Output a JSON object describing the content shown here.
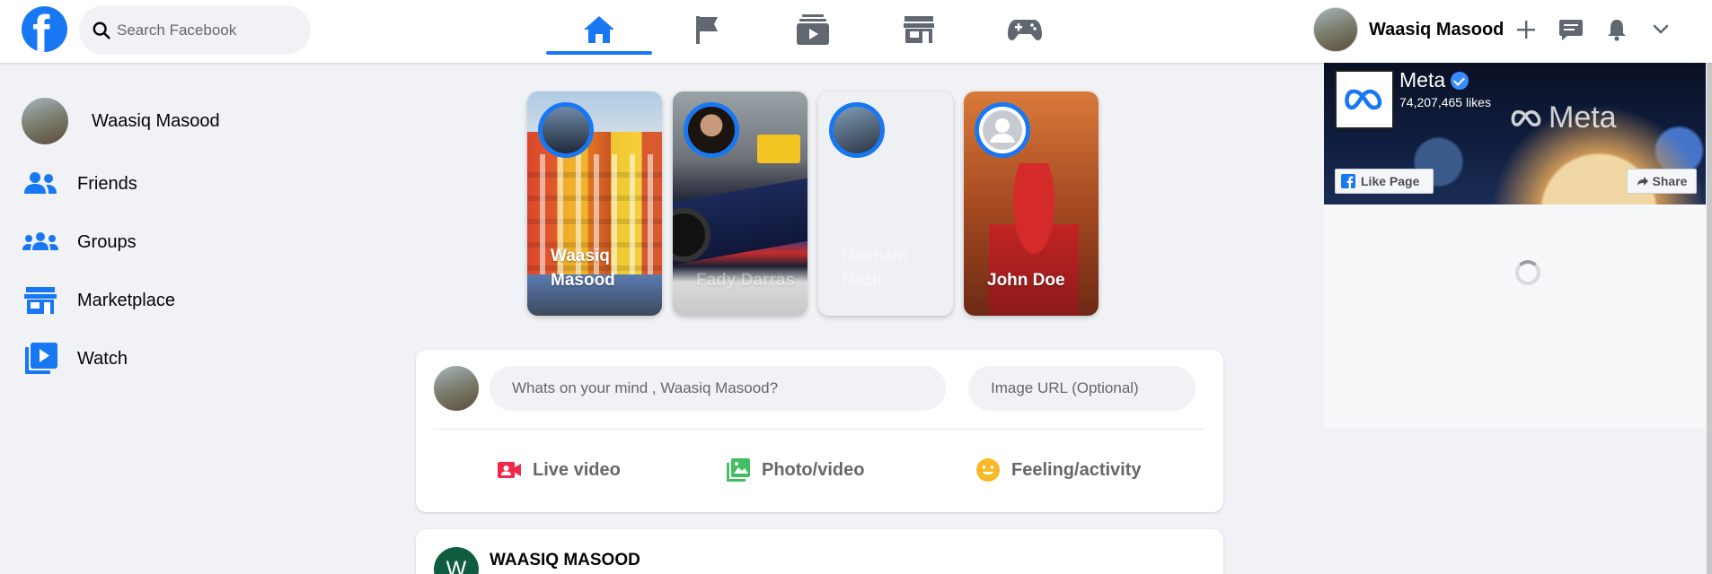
{
  "header": {
    "search": {
      "placeholder": "Search Facebook"
    },
    "nav_tabs": [
      {
        "name": "home",
        "icon": "home-icon",
        "active": true
      },
      {
        "name": "pages",
        "icon": "flag-icon",
        "active": false
      },
      {
        "name": "watch",
        "icon": "video-icon",
        "active": false
      },
      {
        "name": "marketplace",
        "icon": "store-icon",
        "active": false
      },
      {
        "name": "gaming",
        "icon": "gamepad-icon",
        "active": false
      }
    ],
    "profile_name": "Waasiq Masood"
  },
  "sidebar": {
    "profile_name": "Waasiq Masood",
    "items": [
      {
        "label": "Friends",
        "icon": "friends-icon"
      },
      {
        "label": "Groups",
        "icon": "groups-icon"
      },
      {
        "label": "Marketplace",
        "icon": "store-icon"
      },
      {
        "label": "Watch",
        "icon": "video-icon"
      }
    ]
  },
  "stories": [
    {
      "name": "Waasiq Masood"
    },
    {
      "name": "Fady Darras"
    },
    {
      "name": "Hasnain Nazir"
    },
    {
      "name": "John Doe"
    }
  ],
  "composer": {
    "placeholder": "Whats on your mind , Waasiq Masood?",
    "image_placeholder": "Image URL (Optional)",
    "actions": [
      {
        "label": "Live video",
        "icon": "live-video-icon",
        "color": "#f02849"
      },
      {
        "label": "Photo/video",
        "icon": "photo-icon",
        "color": "#45bd62"
      },
      {
        "label": "Feeling/activity",
        "icon": "emoji-icon",
        "color": "#f7b928"
      }
    ]
  },
  "post": {
    "author_initial": "W",
    "author": "WAASIQ MASOOD"
  },
  "page_plugin": {
    "title": "Meta",
    "likes": "74,207,465 likes",
    "watermark": "Meta",
    "like_button": "Like Page",
    "share_button": "Share"
  },
  "colors": {
    "accent": "#1877f2",
    "background": "#f0f2f5",
    "text_secondary": "#65676b"
  }
}
